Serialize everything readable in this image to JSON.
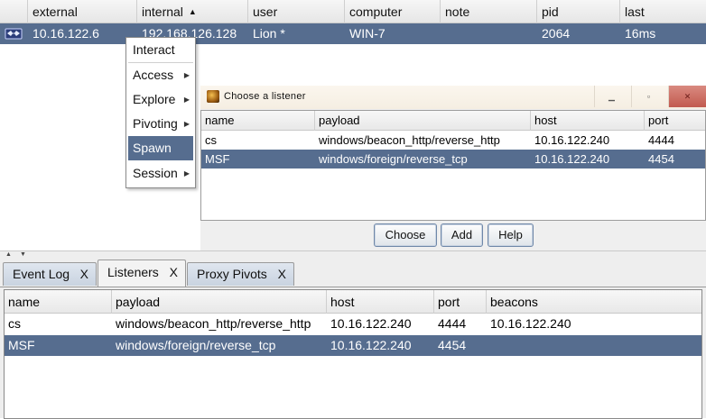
{
  "sessions": {
    "columns": [
      "",
      "external",
      "internal",
      "user",
      "computer",
      "note",
      "pid",
      "last"
    ],
    "sort_indicator": "▲",
    "row": {
      "icon": "beacon-session-icon",
      "external": "10.16.122.6",
      "internal": "192.168.126.128",
      "user": "Lion *",
      "computer": "WIN-7",
      "note": "",
      "pid": "2064",
      "last": "16ms"
    }
  },
  "context_menu": {
    "items": [
      {
        "label": "Interact",
        "submenu": false
      },
      {
        "label": "Access",
        "submenu": true
      },
      {
        "label": "Explore",
        "submenu": true
      },
      {
        "label": "Pivoting",
        "submenu": true
      },
      {
        "label": "Spawn",
        "submenu": false,
        "selected": true
      },
      {
        "label": "Session",
        "submenu": true
      }
    ],
    "arrow_glyph": "▶"
  },
  "listener_dialog": {
    "title": "Choose a listener",
    "window_buttons": {
      "minimize": "▁",
      "maximize": "▫",
      "close": "✕"
    },
    "columns": [
      "name",
      "payload",
      "host",
      "port"
    ],
    "rows": [
      {
        "name": "cs",
        "payload": "windows/beacon_http/reverse_http",
        "host": "10.16.122.240",
        "port": "4444"
      },
      {
        "name": "MSF",
        "payload": "windows/foreign/reverse_tcp",
        "host": "10.16.122.240",
        "port": "4454"
      }
    ],
    "buttons": {
      "choose": "Choose",
      "add": "Add",
      "help": "Help"
    }
  },
  "tabs": [
    {
      "label": "Event Log",
      "close": "X"
    },
    {
      "label": "Listeners",
      "close": "X",
      "active": true
    },
    {
      "label": "Proxy Pivots",
      "close": "X"
    }
  ],
  "listeners": {
    "columns": [
      "name",
      "payload",
      "host",
      "port",
      "beacons"
    ],
    "rows": [
      {
        "name": "cs",
        "payload": "windows/beacon_http/reverse_http",
        "host": "10.16.122.240",
        "port": "4444",
        "beacons": "10.16.122.240"
      },
      {
        "name": "MSF",
        "payload": "windows/foreign/reverse_tcp",
        "host": "10.16.122.240",
        "port": "4454",
        "beacons": ""
      }
    ]
  },
  "colors": {
    "selection": "#566d8f",
    "button_border": "#6f87a8",
    "close_button": "#c25a4f"
  }
}
